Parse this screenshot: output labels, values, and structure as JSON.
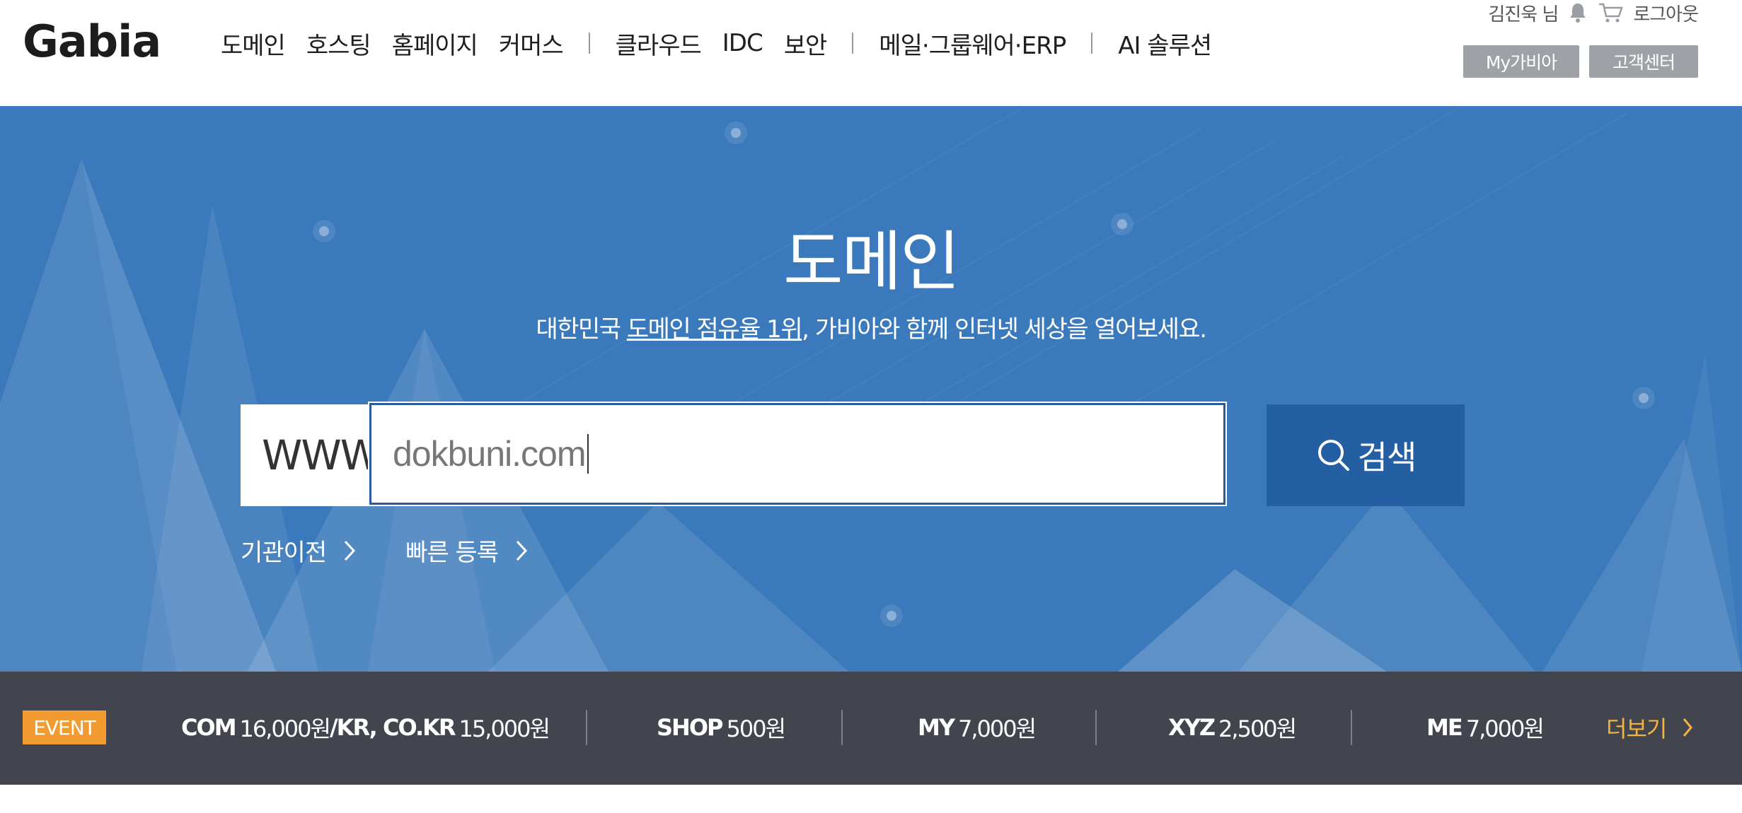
{
  "header": {
    "logo": "Gabia",
    "nav": [
      "도메인",
      "호스팅",
      "홈페이지",
      "커머스",
      "클라우드",
      "IDC",
      "보안",
      "메일·그룹웨어·ERP",
      "AI 솔루션"
    ],
    "user": "김진욱 님",
    "logout": "로그아웃",
    "my_gabia": "My가비아",
    "customer_center": "고객센터"
  },
  "hero": {
    "title": "도메인",
    "subtitle_pre": "대한민국 ",
    "subtitle_link": "도메인 점유율 1위",
    "subtitle_post": ", 가비아와 함께 인터넷 세상을 열어보세요.",
    "www_prefix": "WWW.",
    "search_value": "dokbuni.com",
    "search_button": "검색",
    "links": [
      "기관이전",
      "빠른 등록"
    ]
  },
  "event": {
    "badge": "EVENT",
    "prices": [
      {
        "label": "COM",
        "price": "16,000원",
        "sep": " / ",
        "label2": "KR, CO.KR",
        "price2": "15,000원"
      },
      {
        "label": "SHOP",
        "price": "500원"
      },
      {
        "label": "MY",
        "price": "7,000원"
      },
      {
        "label": "XYZ",
        "price": "2,500원"
      },
      {
        "label": "ME",
        "price": "7,000원"
      }
    ],
    "more": "더보기"
  },
  "colors": {
    "hero_bg": "#3a79bb",
    "search_button": "#245fa3",
    "event_bar": "#42454e",
    "event_badge": "#f19b31",
    "more_link": "#f3b33e"
  }
}
